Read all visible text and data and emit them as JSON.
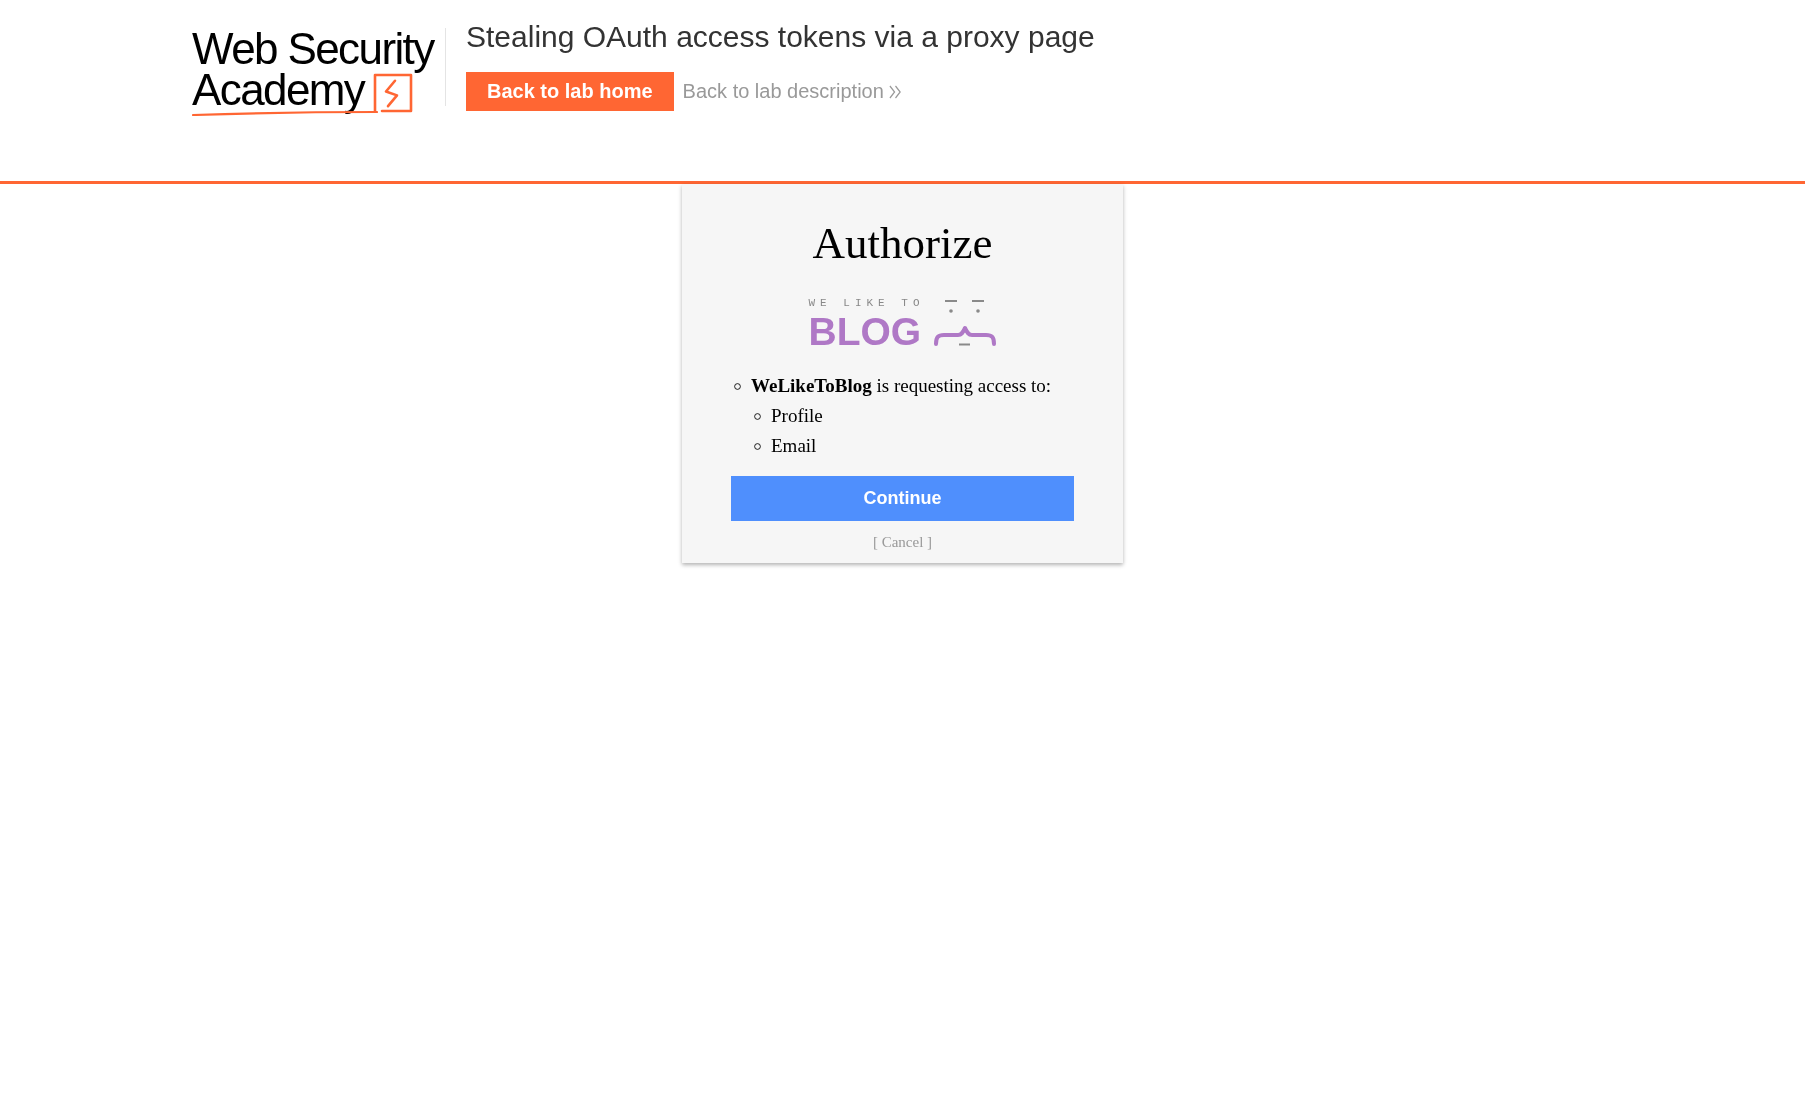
{
  "header": {
    "logo": {
      "line_1": "Web Security",
      "line_2": "Academy"
    },
    "title": "Stealing OAuth access tokens via a proxy page",
    "home_button": "Back to lab home",
    "description_link": "Back to lab description"
  },
  "authorize_card": {
    "title": "Authorize",
    "client_logo": {
      "tagline": "WE LIKE TO",
      "wordmark": "BLOG"
    },
    "request_list": [
      {
        "text": "**WeLikeToBlog** is requesting access to:",
        "children": [
          {
            "text": "Profile"
          },
          {
            "text": "Email"
          }
        ]
      }
    ],
    "continue_button": "Continue",
    "cancel_link": "[ Cancel ]"
  }
}
